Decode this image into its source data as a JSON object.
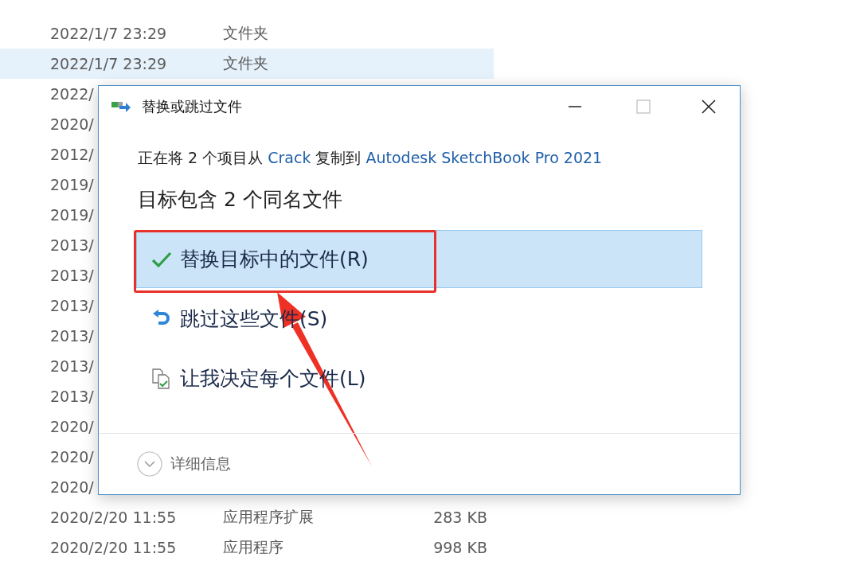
{
  "file_list": {
    "rows": [
      {
        "date": "2022/1/7 23:29",
        "type": "文件夹",
        "selected": false
      },
      {
        "date": "2022/1/7 23:29",
        "type": "文件夹",
        "selected": true
      },
      {
        "date": "2022/",
        "selected": false
      },
      {
        "date": "2020/",
        "selected": false
      },
      {
        "date": "2012/",
        "selected": false
      },
      {
        "date": "2019/",
        "selected": false
      },
      {
        "date": "2019/",
        "selected": false
      },
      {
        "date": "2013/",
        "selected": false
      },
      {
        "date": "2013/",
        "selected": false
      },
      {
        "date": "2013/",
        "selected": false
      },
      {
        "date": "2013/",
        "selected": false
      },
      {
        "date": "2013/",
        "selected": false
      },
      {
        "date": "2013/",
        "selected": false
      },
      {
        "date": "2020/",
        "selected": false
      },
      {
        "date": "2020/",
        "selected": false
      },
      {
        "date": "2020/",
        "selected": false
      },
      {
        "date": "2020/2/20 11:55",
        "type": "应用程序扩展",
        "size": "283 KB",
        "selected": false
      },
      {
        "date": "2020/2/20 11:55",
        "type": "应用程序",
        "size": "998 KB",
        "selected": false
      }
    ]
  },
  "dialog": {
    "title": "替换或跳过文件",
    "message": {
      "prefix": "正在将 2 个项目从 ",
      "source": "Crack",
      "middle": " 复制到 ",
      "destination": "Autodesk SketchBook Pro 2021"
    },
    "heading": "目标包含 2 个同名文件",
    "options": [
      {
        "kind": "replace",
        "label": "替换目标中的文件(R)",
        "selected": true
      },
      {
        "kind": "skip",
        "label": "跳过这些文件(S)",
        "selected": false
      },
      {
        "kind": "decide",
        "label": "让我决定每个文件(L)",
        "selected": false
      }
    ],
    "details": "详细信息"
  }
}
